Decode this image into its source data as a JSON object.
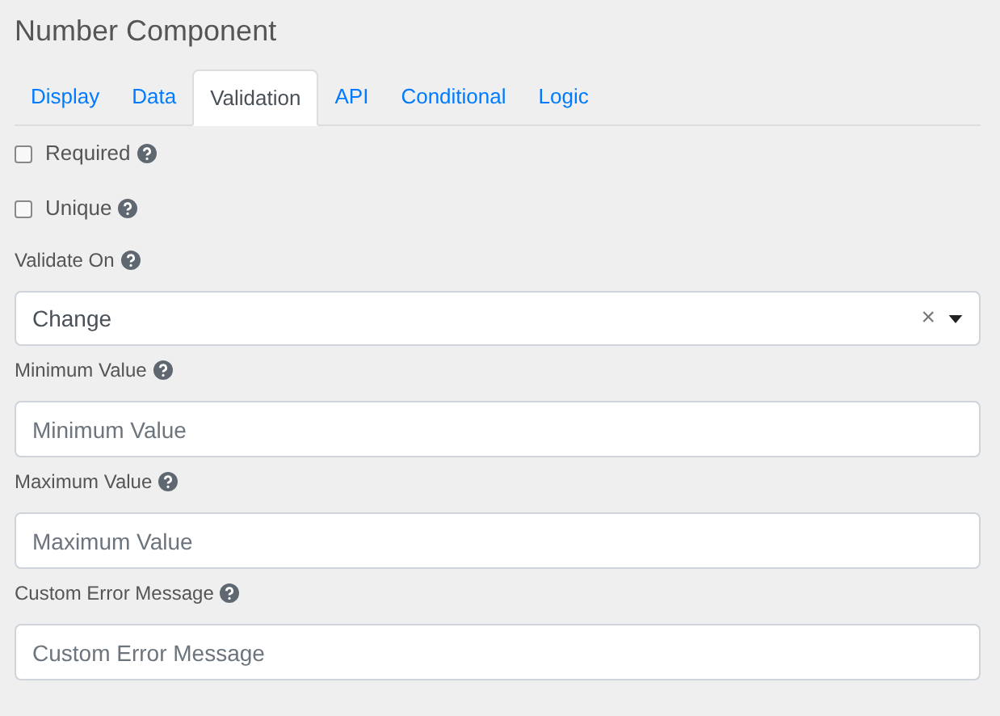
{
  "title": "Number Component",
  "tabs": [
    {
      "label": "Display",
      "selected": false
    },
    {
      "label": "Data",
      "selected": false
    },
    {
      "label": "Validation",
      "selected": true
    },
    {
      "label": "API",
      "selected": false
    },
    {
      "label": "Conditional",
      "selected": false
    },
    {
      "label": "Logic",
      "selected": false
    }
  ],
  "fields": [
    {
      "kind": "checkbox",
      "label": "Required",
      "checked": false
    },
    {
      "kind": "checkbox",
      "label": "Unique",
      "checked": false
    },
    {
      "kind": "select",
      "label": "Validate On",
      "value": "Change",
      "clear": "×"
    },
    {
      "kind": "input",
      "label": "Minimum Value",
      "placeholder": "Minimum Value"
    },
    {
      "kind": "input",
      "label": "Maximum Value",
      "placeholder": "Maximum Value"
    },
    {
      "kind": "input",
      "label": "Custom Error Message",
      "placeholder": "Custom Error Message"
    }
  ]
}
